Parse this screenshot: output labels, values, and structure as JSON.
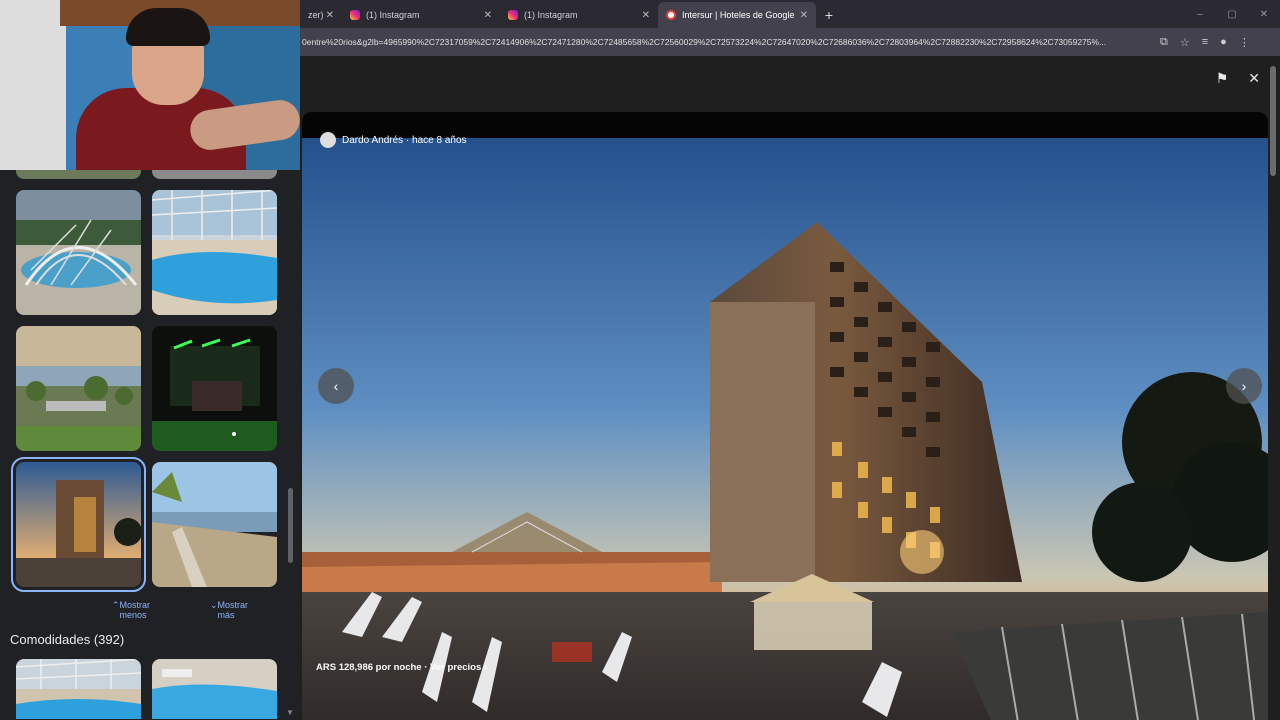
{
  "tabs": [
    {
      "title": "zer)",
      "icon": "page-icon",
      "active": false
    },
    {
      "title": "(1) Instagram",
      "icon": "instagram-icon",
      "active": false
    },
    {
      "title": "(1) Instagram",
      "icon": "instagram-icon",
      "active": false
    },
    {
      "title": "Intersur | Hoteles de Google",
      "icon": "google-icon",
      "active": true
    }
  ],
  "new_tab_label": "+",
  "close_tab_glyph": "✕",
  "window_controls": [
    "–",
    "▢",
    "✕"
  ],
  "address_bar": {
    "url": "0entre%20rios&g2lb=4965990%2C72317059%2C72414906%2C72471280%2C72485658%2C72560029%2C72573224%2C72647020%2C72686036%2C72803964%2C72882230%2C72958624%2C73059275%..."
  },
  "gallery": {
    "show_less": "Mostrar menos",
    "show_more": "Mostrar más",
    "amenities_title": "Comodidades (392)"
  },
  "viewer": {
    "author": "Dardo Andrés · hace 8 años",
    "price": "ARS 128,986 por noche · Ver precios",
    "prev_glyph": "‹",
    "next_glyph": "›"
  },
  "colors": {
    "accent": "#8ab4f8",
    "panel_bg": "#202124",
    "viewer_bg": "#1f1f1f",
    "chrome_bg": "#2b2a33"
  }
}
